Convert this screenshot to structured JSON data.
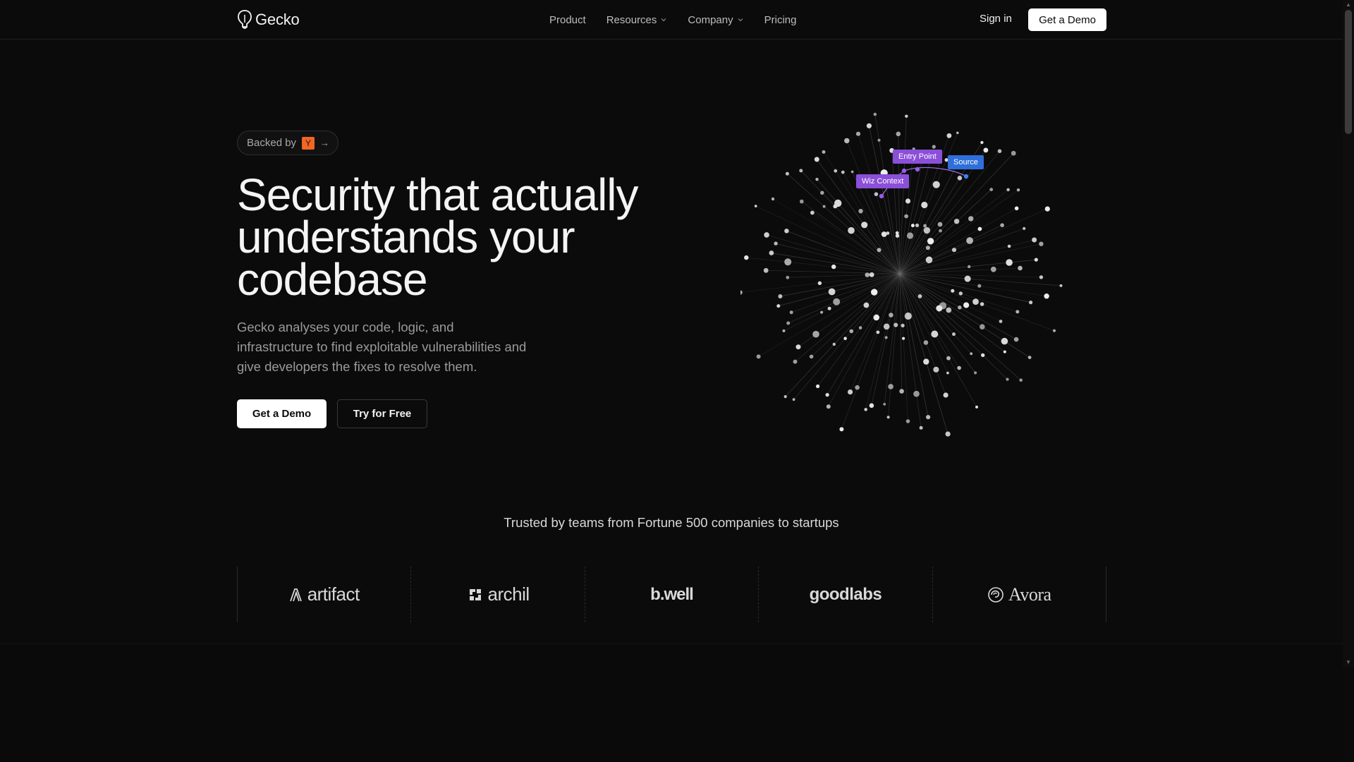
{
  "nav": {
    "logo": "Gecko",
    "items": [
      {
        "label": "Product",
        "has_dropdown": false
      },
      {
        "label": "Resources",
        "has_dropdown": true
      },
      {
        "label": "Company",
        "has_dropdown": true
      },
      {
        "label": "Pricing",
        "has_dropdown": false
      }
    ],
    "signin": "Sign in",
    "cta": "Get a Demo"
  },
  "hero": {
    "badge_text": "Backed by",
    "badge_logo": "Y",
    "headline": "Security that actually understands your codebase",
    "subhead": "Gecko analyses your code, logic, and infrastructure to find exploitable vulnerabilities and give developers the fixes to resolve them.",
    "primary_button": "Get a Demo",
    "secondary_button": "Try for Free"
  },
  "graph": {
    "tags": [
      {
        "label": "Entry Point",
        "color": "#8b4fd9"
      },
      {
        "label": "Source",
        "color": "#2f6fdb"
      },
      {
        "label": "Wiz Context",
        "color": "#8b4fd9"
      }
    ]
  },
  "trusted": {
    "heading": "Trusted by teams from Fortune 500 companies to startups",
    "logos": [
      "artifact",
      "archil",
      "b.well",
      "goodlabs",
      "Avora"
    ]
  },
  "colors": {
    "background": "#0b0b0b",
    "purple_tag": "#8b4fd9",
    "blue_tag": "#2f6fdb",
    "yc_orange": "#f26522"
  }
}
